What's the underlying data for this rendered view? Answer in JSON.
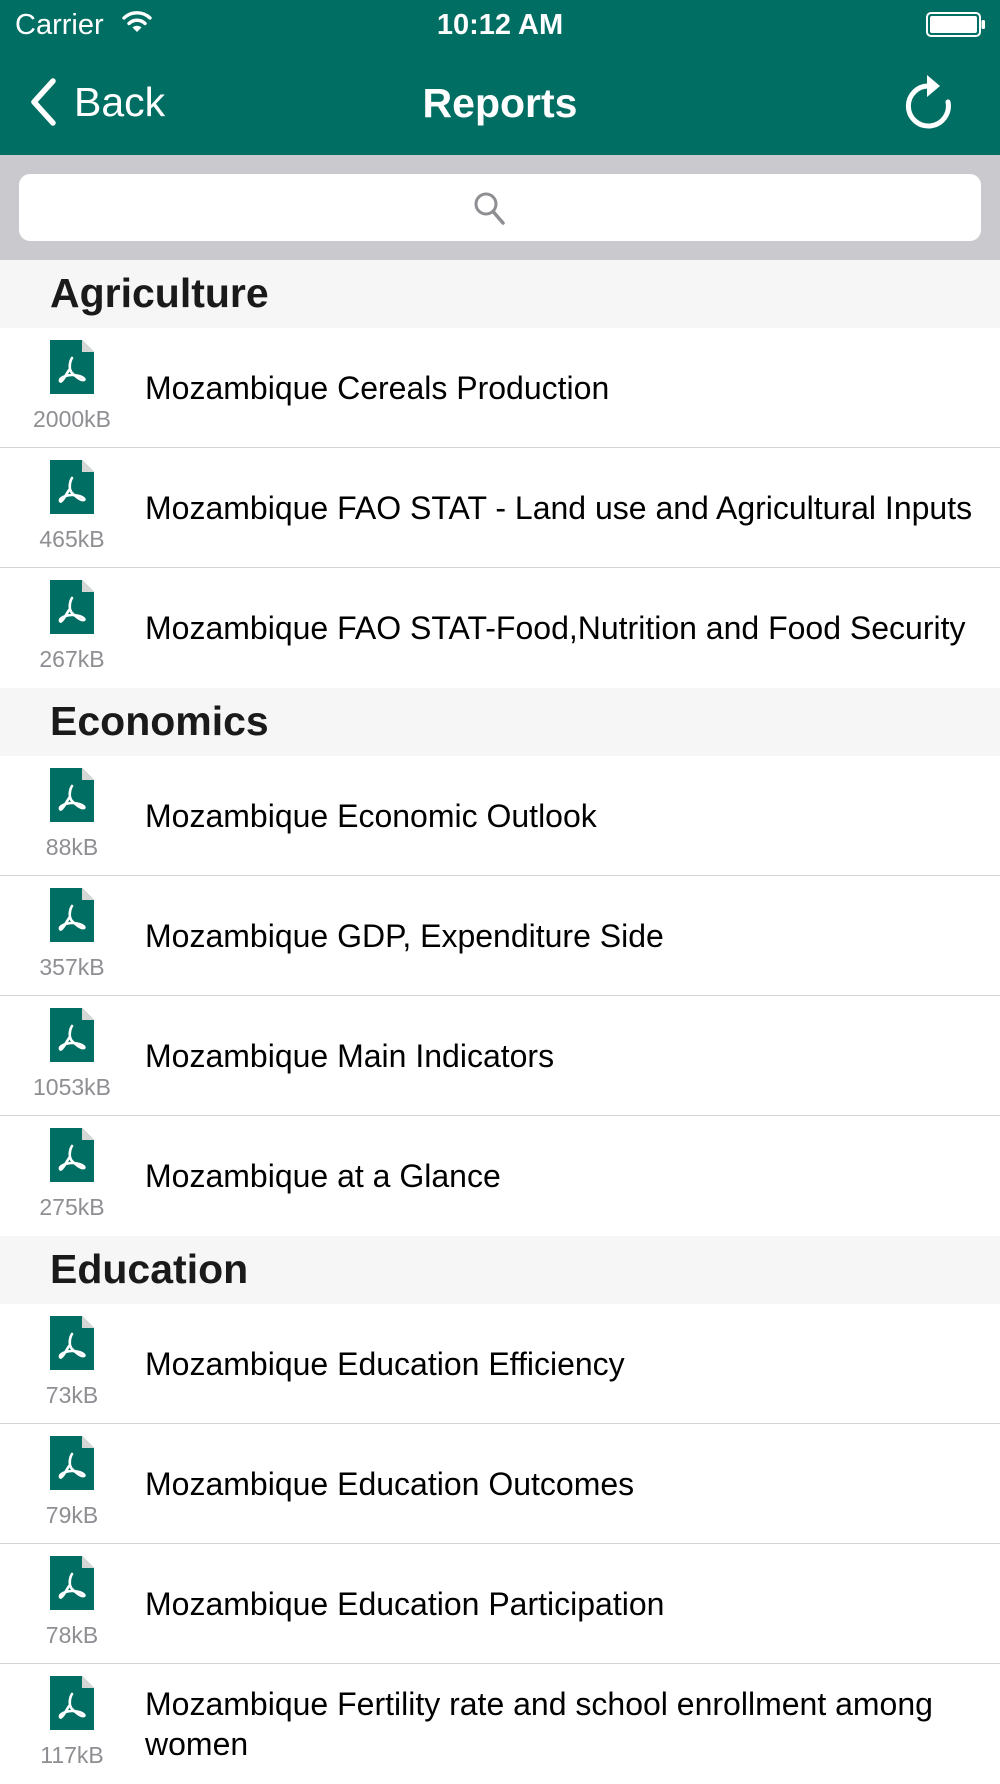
{
  "status_bar": {
    "carrier": "Carrier",
    "time": "10:12 AM"
  },
  "nav": {
    "back_label": "Back",
    "title": "Reports"
  },
  "search": {
    "placeholder": ""
  },
  "colors": {
    "brand": "#006e63",
    "section_bg": "#f6f6f6",
    "search_bar_bg": "#c9c9ce"
  },
  "sections": [
    {
      "title": "Agriculture",
      "items": [
        {
          "title": "Mozambique Cereals Production",
          "size": "2000kB",
          "icon": "pdf-icon"
        },
        {
          "title": "Mozambique FAO STAT - Land use and Agricultural Inputs",
          "size": "465kB",
          "icon": "pdf-icon"
        },
        {
          "title": "Mozambique FAO STAT-Food,Nutrition and Food Security",
          "size": "267kB",
          "icon": "pdf-icon"
        }
      ]
    },
    {
      "title": "Economics",
      "items": [
        {
          "title": "Mozambique Economic Outlook",
          "size": "88kB",
          "icon": "pdf-icon"
        },
        {
          "title": "Mozambique GDP, Expenditure Side",
          "size": "357kB",
          "icon": "pdf-icon"
        },
        {
          "title": "Mozambique Main Indicators",
          "size": "1053kB",
          "icon": "pdf-icon"
        },
        {
          "title": "Mozambique at a Glance",
          "size": "275kB",
          "icon": "pdf-icon"
        }
      ]
    },
    {
      "title": "Education",
      "items": [
        {
          "title": "Mozambique Education Efficiency",
          "size": "73kB",
          "icon": "pdf-icon"
        },
        {
          "title": "Mozambique Education Outcomes",
          "size": "79kB",
          "icon": "pdf-icon"
        },
        {
          "title": "Mozambique Education Participation",
          "size": "78kB",
          "icon": "pdf-icon"
        },
        {
          "title": "Mozambique Fertility rate and school enrollment among women",
          "size": "117kB",
          "icon": "pdf-icon"
        }
      ]
    }
  ]
}
